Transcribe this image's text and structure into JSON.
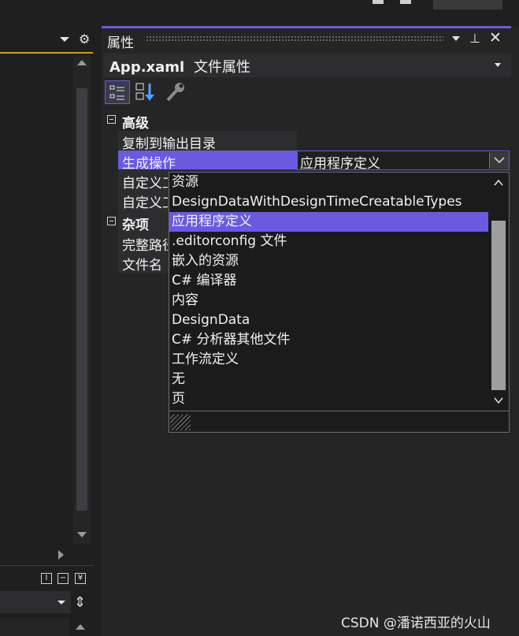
{
  "top": {
    "icons": [
      "minimize-icon",
      "maximize-icon"
    ]
  },
  "left_panel": {
    "icons": [
      "dropdown-arrow-icon",
      "gear-icon",
      "scroll-up-icon",
      "scroll-down-icon",
      "scroll-right-icon"
    ],
    "mini_buttons": [
      "I",
      "−",
      "¥"
    ]
  },
  "properties": {
    "title": "属性",
    "file_name": "App.xaml",
    "file_kind": "文件属性",
    "categories": [
      {
        "name": "高级",
        "props": [
          {
            "name": "复制到输出目录",
            "value": ""
          },
          {
            "name": "生成操作",
            "value": "应用程序定义"
          },
          {
            "name": "自定义工具",
            "value": ""
          },
          {
            "name": "自定义工具命名空间",
            "value": ""
          }
        ]
      },
      {
        "name": "杂项",
        "props": [
          {
            "name": "完整路径",
            "value": ""
          },
          {
            "name": "文件名",
            "value": ""
          }
        ]
      }
    ]
  },
  "dropdown": {
    "selected": "应用程序定义",
    "options": [
      "资源",
      "DesignDataWithDesignTimeCreatableTypes",
      "应用程序定义",
      ".editorconfig 文件",
      "嵌入的资源",
      "C# 编译器",
      "内容",
      "DesignData",
      "C# 分析器其他文件",
      "工作流定义",
      "无",
      "页"
    ]
  },
  "watermark": "CSDN @潘诺西亚的火山",
  "colors": {
    "accent": "#6a5ae0",
    "background": "#1f1f1f",
    "panel": "#252526",
    "left_accent": "#c9a400"
  }
}
